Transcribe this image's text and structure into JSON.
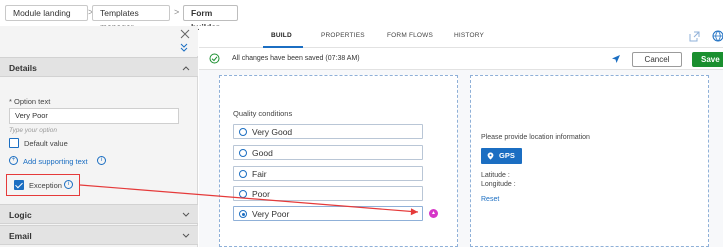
{
  "breadcrumb": {
    "items": [
      "Module landing",
      "Templates manager",
      "Form builder"
    ],
    "separator": ">"
  },
  "left_panel": {
    "details": {
      "title": "Details"
    },
    "option_text_label": "* Option text",
    "option_text_value": "Very Poor",
    "hint": "Type your option",
    "default_value_label": "Default value",
    "add_supporting_text": "Add supporting text",
    "exception_label": "Exception",
    "logic": {
      "title": "Logic"
    },
    "email": {
      "title": "Email"
    }
  },
  "tabs": [
    "BUILD",
    "PROPERTIES",
    "FORM FLOWS",
    "HISTORY"
  ],
  "status": {
    "saved_text": "All changes have been saved (07:38 AM)",
    "cancel_label": "Cancel",
    "save_label": "Save"
  },
  "form": {
    "quality_label": "Quality conditions",
    "options": [
      "Very Good",
      "Good",
      "Fair",
      "Poor",
      "Very Poor"
    ],
    "selected_index": 4,
    "location_prompt": "Please provide location information",
    "gps_label": "GPS",
    "latitude_label": "Latitude :",
    "longitude_label": "Longitude :",
    "reset_label": "Reset"
  },
  "colors": {
    "accent": "#1b6ec2",
    "save": "#1a8f2f",
    "callout": "#e53a3a",
    "marker": "#d636c8"
  }
}
